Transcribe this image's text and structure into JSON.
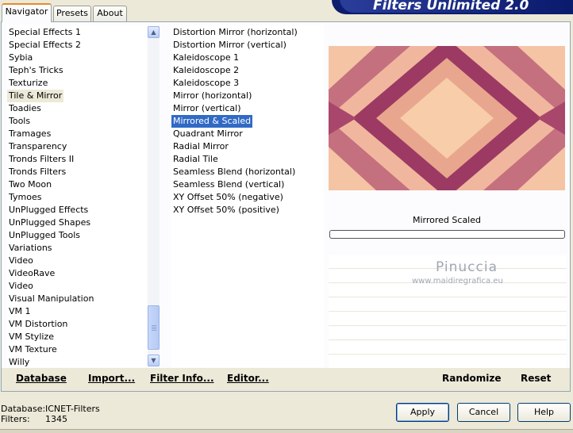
{
  "tabs": [
    {
      "label": "Navigator"
    },
    {
      "label": "Presets"
    },
    {
      "label": "About"
    }
  ],
  "banner": {
    "title": "Filters Unlimited 2.0"
  },
  "categories": {
    "items": [
      "Special Effects 1",
      "Special Effects 2",
      "Sybia",
      "Teph's Tricks",
      "Texturize",
      "Tile & Mirror",
      "Toadies",
      "Tools",
      "Tramages",
      "Transparency",
      "Tronds Filters II",
      "Tronds Filters",
      "Two Moon",
      "Tymoes",
      "UnPlugged Effects",
      "UnPlugged Shapes",
      "UnPlugged Tools",
      "Variations",
      "Video",
      "VideoRave",
      "Video",
      "Visual Manipulation",
      "VM 1",
      "VM Distortion",
      "VM Stylize",
      "VM Texture",
      "Willy"
    ],
    "selected_index": 5
  },
  "filters": {
    "items": [
      "Distortion Mirror (horizontal)",
      "Distortion Mirror (vertical)",
      "Kaleidoscope 1",
      "Kaleidoscope 2",
      "Kaleidoscope 3",
      "Mirror (horizontal)",
      "Mirror (vertical)",
      "Mirrored & Scaled",
      "Quadrant Mirror",
      "Radial Mirror",
      "Radial Tile",
      "Seamless Blend (horizontal)",
      "Seamless Blend (vertical)",
      "XY Offset 50% (negative)",
      "XY Offset 50% (positive)"
    ],
    "selected_index": 7
  },
  "preview": {
    "filter_name": "Mirrored  Scaled",
    "watermark_name": "Pinuccia",
    "watermark_url": "www.maidiregrafica.eu",
    "colors": {
      "dark": "#a8476b",
      "mid": "#d58a8e",
      "light": "#f4c4a4",
      "deep": "#8e2f58"
    }
  },
  "toolbar": {
    "database": "Database",
    "import": "Import...",
    "filter_info": "Filter Info...",
    "editor": "Editor...",
    "randomize": "Randomize",
    "reset": "Reset"
  },
  "status": {
    "database_label": "Database:",
    "database_value": "ICNET-Filters",
    "filters_label": "Filters:",
    "filters_value": "1345"
  },
  "buttons": {
    "apply": "Apply",
    "cancel": "Cancel",
    "help": "Help"
  }
}
